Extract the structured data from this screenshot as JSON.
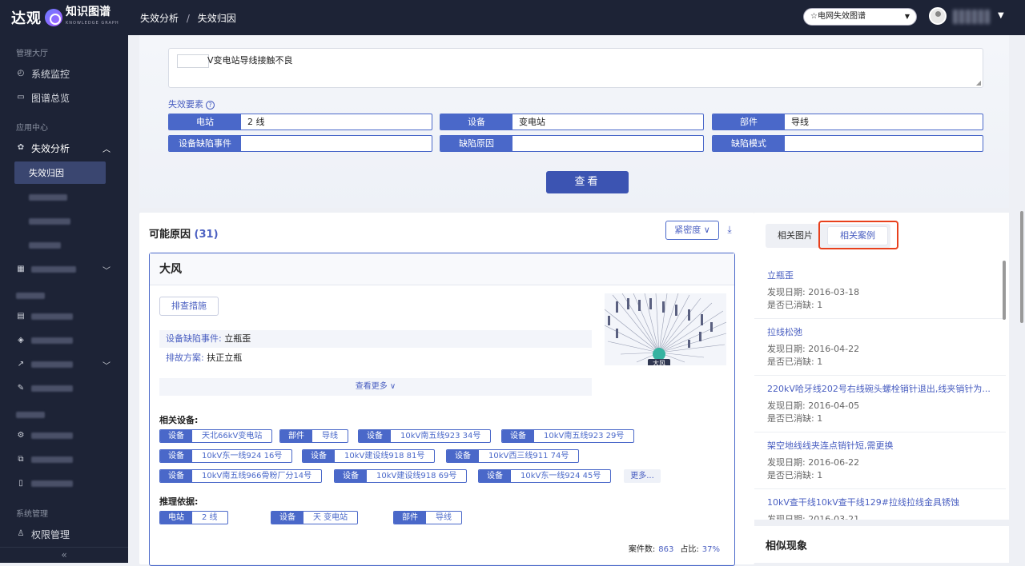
{
  "app": {
    "brand": "达观",
    "product": "知识图谱",
    "product_sub": "KNOWLEDGE GRAPH"
  },
  "sidebar": {
    "group_admin": "管理大厅",
    "item_monitor": "系统监控",
    "item_overview": "图谱总览",
    "group_app": "应用中心",
    "item_failure": "失效分析",
    "sub_attribution": "失效归因",
    "group_system": "系统管理",
    "item_permission": "权限管理",
    "collapse": "«"
  },
  "topbar": {
    "breadcrumb_1": "失效分析",
    "breadcrumb_sep": "/",
    "breadcrumb_2": "失效归因",
    "graph_select": "☆电网失效图谱"
  },
  "query": {
    "text": "V变电站导线接触不良",
    "section_label": "失效要素",
    "fields": [
      {
        "label": "电站",
        "value": "2 线"
      },
      {
        "label": "设备",
        "value": "变电站"
      },
      {
        "label": "部件",
        "value": "导线"
      },
      {
        "label": "设备缺陷事件",
        "value": ""
      },
      {
        "label": "缺陷原因",
        "value": ""
      },
      {
        "label": "缺陷模式",
        "value": ""
      }
    ],
    "view_button": "查看"
  },
  "causes": {
    "title": "可能原因",
    "count": "(31)",
    "sort_label": "紧密度 ∨",
    "card": {
      "title": "大风",
      "check_button": "排查措施",
      "event_key": "设备缺陷事件:",
      "event_val": "立瓶歪",
      "plan_key": "排故方案:",
      "plan_val": "扶正立瓶",
      "more": "查看更多 ∨",
      "graph_center": "大风",
      "related_title": "相关设备:",
      "related_tags": [
        {
          "label": "设备",
          "value": "天北66kV变电站"
        },
        {
          "label": "部件",
          "value": "导线"
        },
        {
          "label": "设备",
          "value": "10kV南五线923 34号"
        },
        {
          "label": "设备",
          "value": "10kV南五线923 29号"
        },
        {
          "label": "设备",
          "value": "10kV东一线924 16号"
        },
        {
          "label": "设备",
          "value": "10kV建设线918 81号"
        },
        {
          "label": "设备",
          "value": "10kV西三线911 74号"
        },
        {
          "label": "设备",
          "value": "10kV南五线966骨粉厂分14号"
        },
        {
          "label": "设备",
          "value": "10kV建设线918 69号"
        },
        {
          "label": "设备",
          "value": "10kV东一线924 45号"
        }
      ],
      "more_tag": "更多...",
      "basis_title": "推理依据:",
      "basis_tags": [
        {
          "label": "电站",
          "value": "2 线"
        },
        {
          "label": "设备",
          "value": "天 变电站"
        },
        {
          "label": "部件",
          "value": "导线"
        }
      ],
      "case_count_label": "案件数:",
      "case_count": "863",
      "ratio_label": "占比:",
      "ratio": "37%"
    }
  },
  "right": {
    "tab_images": "相关图片",
    "tab_cases": "相关案例",
    "cases": [
      {
        "title": "立瓶歪",
        "date": "发现日期: 2016-03-18",
        "status": "是否已消缺: 1"
      },
      {
        "title": "拉线松弛",
        "date": "发现日期: 2016-04-22",
        "status": "是否已消缺: 1"
      },
      {
        "title": "220kV哈牙线202号右线碗头螺栓销针退出,线夹销针为...",
        "date": "发现日期: 2016-04-05",
        "status": "是否已消缺: 1"
      },
      {
        "title": "架空地线线夹连点销针短,需更换",
        "date": "发现日期: 2016-06-22",
        "status": "是否已消缺: 1"
      },
      {
        "title": "10kV查干线10kV查干线129#拉线拉线金具锈蚀",
        "date": "发现日期: 2016-03-21",
        "status": ""
      }
    ],
    "similar_title": "相似现象"
  },
  "colors": {
    "primary": "#4a68c9",
    "sidebar_bg": "#1d2336",
    "highlight": "#e8401c"
  }
}
